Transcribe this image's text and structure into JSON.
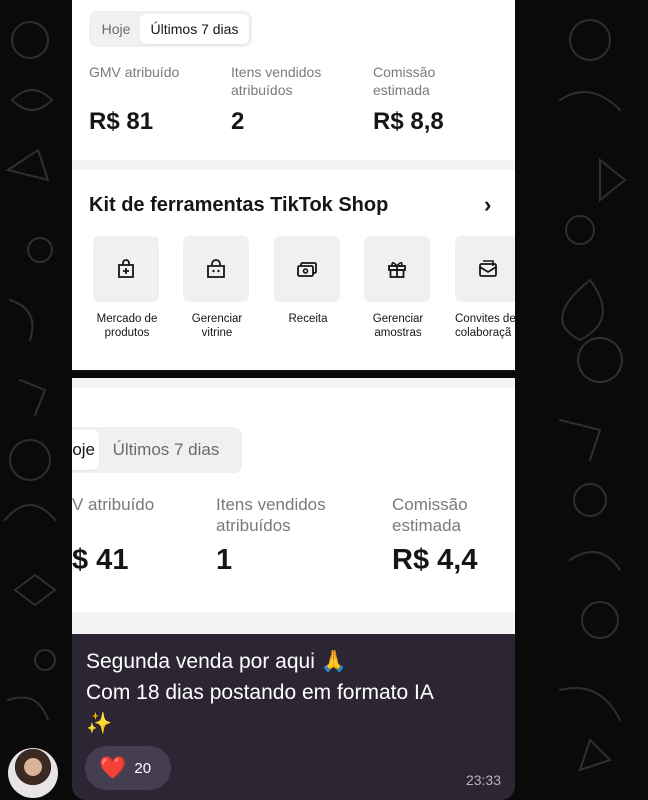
{
  "top_card": {
    "tabs": [
      "Hoje",
      "Últimos 7 dias"
    ],
    "active_tab": "Últimos 7 dias",
    "metrics": [
      {
        "label": "GMV atribuído",
        "value": "R$ 81"
      },
      {
        "label": "Itens vendidos atribuídos",
        "value": "2"
      },
      {
        "label": "Comissão estimada",
        "value": "R$ 8,8"
      }
    ]
  },
  "toolkit": {
    "title": "Kit de ferramentas TikTok Shop",
    "chevron": "›",
    "tools": [
      {
        "label_line1": "Mercado de",
        "label_line2": "produtos",
        "icon": "shopping-bag-plus-icon"
      },
      {
        "label_line1": "Gerenciar",
        "label_line2": "vitrine",
        "icon": "bag-face-icon"
      },
      {
        "label_line1": "Receita",
        "label_line2": "",
        "icon": "banknotes-icon"
      },
      {
        "label_line1": "Gerenciar",
        "label_line2": "amostras",
        "icon": "gift-icon"
      },
      {
        "label_line1": "Convites de",
        "label_line2": "colaboraçã",
        "icon": "envelope-icon"
      }
    ]
  },
  "bottom_card": {
    "tabs": [
      "oje",
      "Últimos 7 dias"
    ],
    "active_tab": "oje",
    "metrics": [
      {
        "label": "V atribuído",
        "value": "$ 41"
      },
      {
        "label": "Itens vendidos atribuídos",
        "value": "1"
      },
      {
        "label": "Comissão estimada",
        "value": "R$ 4,4"
      }
    ]
  },
  "message": {
    "line1": "Segunda venda por aqui 🙏",
    "line2": "Com 18 dias postando em formato IA",
    "line3": "✨",
    "reaction_emoji": "❤️",
    "reaction_count": "20",
    "time": "23:33"
  },
  "colors": {
    "background": "#0a0a0a",
    "bubble": "#2c2634",
    "reaction_pill": "#453d50",
    "heart": "#e0245e"
  }
}
